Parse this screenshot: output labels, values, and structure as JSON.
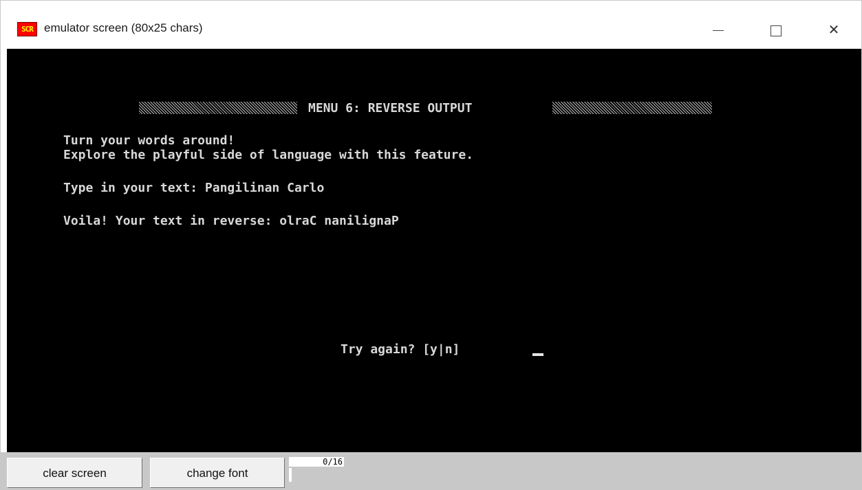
{
  "window": {
    "icon_text": "SCR",
    "title": "emulator screen (80x25 chars)"
  },
  "terminal": {
    "menu_title": "MENU 6: REVERSE OUTPUT",
    "line1": "Turn your words around!",
    "line2": "Explore the playful side of language with this feature.",
    "line3": "Type in your text: Pangilinan Carlo",
    "line4": "Voila! Your text in reverse: olraC nanilignaP",
    "prompt": "Try again? [y|n]"
  },
  "toolbar": {
    "clear_label": "clear screen",
    "font_label": "change font",
    "counter": "0/16",
    "counter_fraction": 0
  },
  "colors": {
    "screen_bg": "#000000",
    "screen_fg": "#d8d8d8",
    "bar_bg": "#c8c8c8"
  }
}
